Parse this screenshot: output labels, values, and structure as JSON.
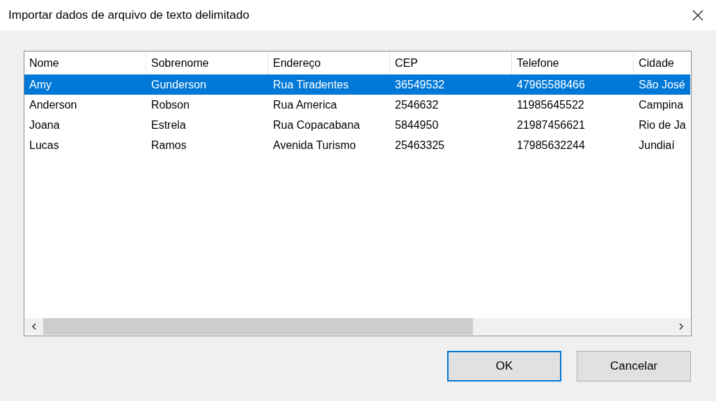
{
  "window": {
    "title": "Importar dados de arquivo de texto delimitado"
  },
  "table": {
    "columns": [
      "Nome",
      "Sobrenome",
      "Endereço",
      "CEP",
      "Telefone",
      "Cidade"
    ],
    "rows": [
      {
        "selected": true,
        "cells": [
          "Amy",
          "Gunderson",
          "Rua Tiradentes",
          "36549532",
          "47965588466",
          "São José"
        ]
      },
      {
        "selected": false,
        "cells": [
          "Anderson",
          "Robson",
          "Rua America",
          "2546632",
          "11985645522",
          "Campina"
        ]
      },
      {
        "selected": false,
        "cells": [
          "Joana",
          "Estrela",
          "Rua Copacabana",
          "5844950",
          "21987456621",
          "Rio de Ja"
        ]
      },
      {
        "selected": false,
        "cells": [
          "Lucas",
          "Ramos",
          "Avenida Turismo",
          "25463325",
          "17985632244",
          "Jundiaí"
        ]
      }
    ]
  },
  "buttons": [
    {
      "label": "OK",
      "default": true
    },
    {
      "label": "Cancelar",
      "default": false
    }
  ]
}
